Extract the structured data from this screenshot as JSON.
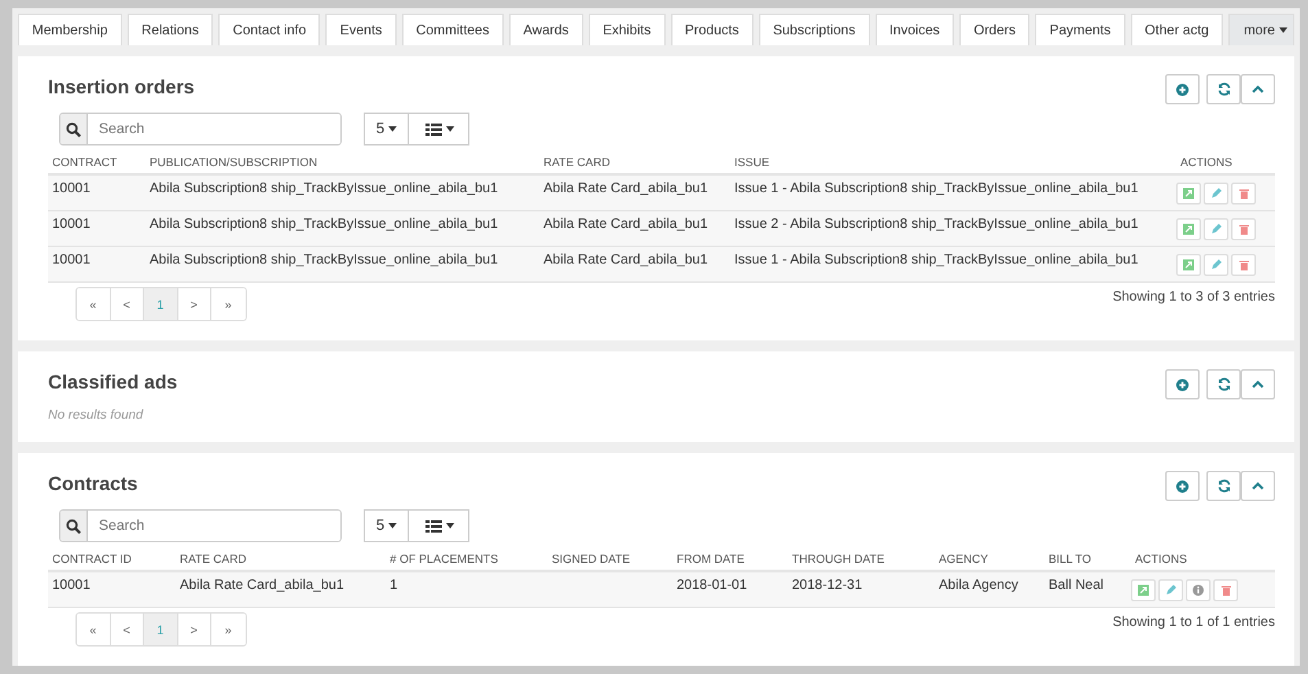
{
  "tabs": [
    {
      "label": "Membership"
    },
    {
      "label": "Relations"
    },
    {
      "label": "Contact info"
    },
    {
      "label": "Events"
    },
    {
      "label": "Committees"
    },
    {
      "label": "Awards"
    },
    {
      "label": "Exhibits"
    },
    {
      "label": "Products"
    },
    {
      "label": "Subscriptions"
    },
    {
      "label": "Invoices"
    },
    {
      "label": "Orders"
    },
    {
      "label": "Payments"
    },
    {
      "label": "Other actg"
    }
  ],
  "more_tab": {
    "label": "more"
  },
  "panels": [
    {
      "title": "Insertion orders",
      "search_placeholder": "Search",
      "page_size": "5",
      "columns": [
        "CONTRACT",
        "PUBLICATION/SUBSCRIPTION",
        "RATE CARD",
        "ISSUE",
        "ACTIONS"
      ],
      "rows": [
        {
          "cells": [
            "10001",
            "Abila Subscription8 ship_TrackByIssue_online_abila_bu1",
            "Abila Rate Card_abila_bu1",
            "Issue 1 - Abila Subscription8 ship_TrackByIssue_online_abila_bu1"
          ],
          "actions": [
            {
              "kind": "view"
            },
            {
              "kind": "edit"
            },
            {
              "kind": "delete"
            }
          ]
        },
        {
          "cells": [
            "10001",
            "Abila Subscription8 ship_TrackByIssue_online_abila_bu1",
            "Abila Rate Card_abila_bu1",
            "Issue 2 - Abila Subscription8 ship_TrackByIssue_online_abila_bu1"
          ],
          "actions": [
            {
              "kind": "view"
            },
            {
              "kind": "edit"
            },
            {
              "kind": "delete"
            }
          ]
        },
        {
          "cells": [
            "10001",
            "Abila Subscription8 ship_TrackByIssue_online_abila_bu1",
            "Abila Rate Card_abila_bu1",
            "Issue 1 - Abila Subscription8 ship_TrackByIssue_online_abila_bu1"
          ],
          "actions": [
            {
              "kind": "view"
            },
            {
              "kind": "edit"
            },
            {
              "kind": "delete"
            }
          ]
        }
      ],
      "pagination": [
        {
          "label": "«",
          "selected": false
        },
        {
          "label": "<",
          "selected": false
        },
        {
          "label": "1",
          "selected": true
        },
        {
          "label": ">",
          "selected": false
        },
        {
          "label": "»",
          "selected": false
        }
      ],
      "summary": "Showing 1 to 3 of 3 entries"
    },
    {
      "title": "Classified ads",
      "empty_message": "No results found"
    },
    {
      "title": "Contracts",
      "search_placeholder": "Search",
      "page_size": "5",
      "columns": [
        "CONTRACT ID",
        "RATE CARD",
        "# OF PLACEMENTS",
        "SIGNED DATE",
        "FROM DATE",
        "THROUGH DATE",
        "AGENCY",
        "BILL TO",
        "ACTIONS"
      ],
      "rows": [
        {
          "cells": [
            "10001",
            "Abila Rate Card_abila_bu1",
            "1",
            "",
            "2018-01-01",
            "2018-12-31",
            "Abila Agency",
            "Ball Neal"
          ],
          "actions": [
            {
              "kind": "view"
            },
            {
              "kind": "edit"
            },
            {
              "kind": "info"
            },
            {
              "kind": "delete"
            }
          ]
        }
      ],
      "pagination": [
        {
          "label": "«",
          "selected": false
        },
        {
          "label": "<",
          "selected": false
        },
        {
          "label": "1",
          "selected": true
        },
        {
          "label": ">",
          "selected": false
        },
        {
          "label": "»",
          "selected": false
        }
      ],
      "summary": "Showing 1 to 1 of 1 entries"
    }
  ]
}
